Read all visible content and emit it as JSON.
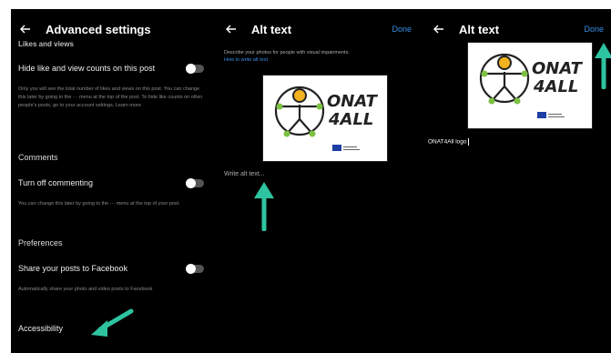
{
  "colors": {
    "background": "#000000",
    "accent": "#3a8ee6",
    "arrow": "#2ec4a0",
    "toggle_track": "#555555"
  },
  "panel1": {
    "title": "Advanced settings",
    "likes_header": "Likes and views",
    "hide_likes_label": "Hide like and view counts on this post",
    "hide_likes_desc": "Only you will see the total number of likes and views on this post. You can change this later by going to the ··· menu at the top of the post. To hide like counts on other people's posts, go to your account settings. Learn more",
    "comments_header": "Comments",
    "turn_off_label": "Turn off commenting",
    "turn_off_desc": "You can change this later by going to the ··· menu at the top of your post.",
    "preferences_header": "Preferences",
    "share_label": "Share your posts to Facebook",
    "share_desc": "Automatically share your photo and video posts to Facebook",
    "accessibility_label": "Accessibility"
  },
  "panel2": {
    "title": "Alt text",
    "done": "Done",
    "description": "Describe your photos for people with visual impairments.",
    "how_to": "How to write alt text",
    "placeholder": "Write alt text...",
    "logo_line1": "ONAT",
    "logo_line2": "4ALL"
  },
  "panel3": {
    "title": "Alt text",
    "done": "Done",
    "alt_value": "ONAT4All logo",
    "logo_line1": "ONAT",
    "logo_line2": "4ALL"
  }
}
